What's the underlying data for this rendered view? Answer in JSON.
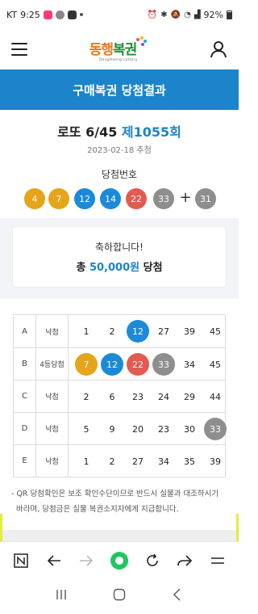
{
  "status_bar": {
    "carrier": "KT",
    "time": "9:25",
    "battery": "92%"
  },
  "header": {
    "logo_text_1": "동행",
    "logo_text_2": "복권",
    "logo_sub": "DongHaeng Lottery"
  },
  "page_title": "구매복권 당첨결과",
  "draw": {
    "game": "로또 6/45",
    "round": "제1055회",
    "date": "2023-02-18 추첨",
    "win_label": "당첨번호",
    "numbers": [
      {
        "value": "4",
        "color": "#e5a41a"
      },
      {
        "value": "7",
        "color": "#e5a41a"
      },
      {
        "value": "12",
        "color": "#1b8ad8"
      },
      {
        "value": "14",
        "color": "#1b8ad8"
      },
      {
        "value": "22",
        "color": "#e35b50"
      },
      {
        "value": "33",
        "color": "#8e8e8e"
      }
    ],
    "plus": "+",
    "bonus": {
      "value": "31",
      "color": "#8e8e8e"
    }
  },
  "prize": {
    "congrats": "축하합니다!",
    "prefix": "총",
    "amount": "50,000원",
    "suffix": "당첨"
  },
  "ticket": {
    "rows": [
      {
        "letter": "A",
        "result": "낙첨",
        "numbers": [
          {
            "v": "1"
          },
          {
            "v": "2"
          },
          {
            "v": "12",
            "color": "#1b8ad8"
          },
          {
            "v": "27"
          },
          {
            "v": "39"
          },
          {
            "v": "45"
          }
        ]
      },
      {
        "letter": "B",
        "result": "4등당첨",
        "numbers": [
          {
            "v": "7",
            "color": "#e5a41a"
          },
          {
            "v": "12",
            "color": "#1b8ad8"
          },
          {
            "v": "22",
            "color": "#e35b50"
          },
          {
            "v": "33",
            "color": "#8e8e8e"
          },
          {
            "v": "34"
          },
          {
            "v": "45"
          }
        ]
      },
      {
        "letter": "C",
        "result": "낙첨",
        "numbers": [
          {
            "v": "2"
          },
          {
            "v": "6"
          },
          {
            "v": "23"
          },
          {
            "v": "24"
          },
          {
            "v": "29"
          },
          {
            "v": "44"
          }
        ]
      },
      {
        "letter": "D",
        "result": "낙첨",
        "numbers": [
          {
            "v": "5"
          },
          {
            "v": "9"
          },
          {
            "v": "20"
          },
          {
            "v": "23"
          },
          {
            "v": "30"
          },
          {
            "v": "33",
            "color": "#8e8e8e"
          }
        ]
      },
      {
        "letter": "E",
        "result": "낙첨",
        "numbers": [
          {
            "v": "1"
          },
          {
            "v": "2"
          },
          {
            "v": "27"
          },
          {
            "v": "34"
          },
          {
            "v": "35"
          },
          {
            "v": "39"
          }
        ]
      }
    ]
  },
  "notice": {
    "line1": "- QR 당첨확인은 보조 확인수단이므로 반드시 실물과 대조하시기",
    "line2": "  바라며, 당첨금은 실물 복권소지자에게 지급합니다."
  },
  "colors": {
    "accent": "#1b84cb"
  }
}
